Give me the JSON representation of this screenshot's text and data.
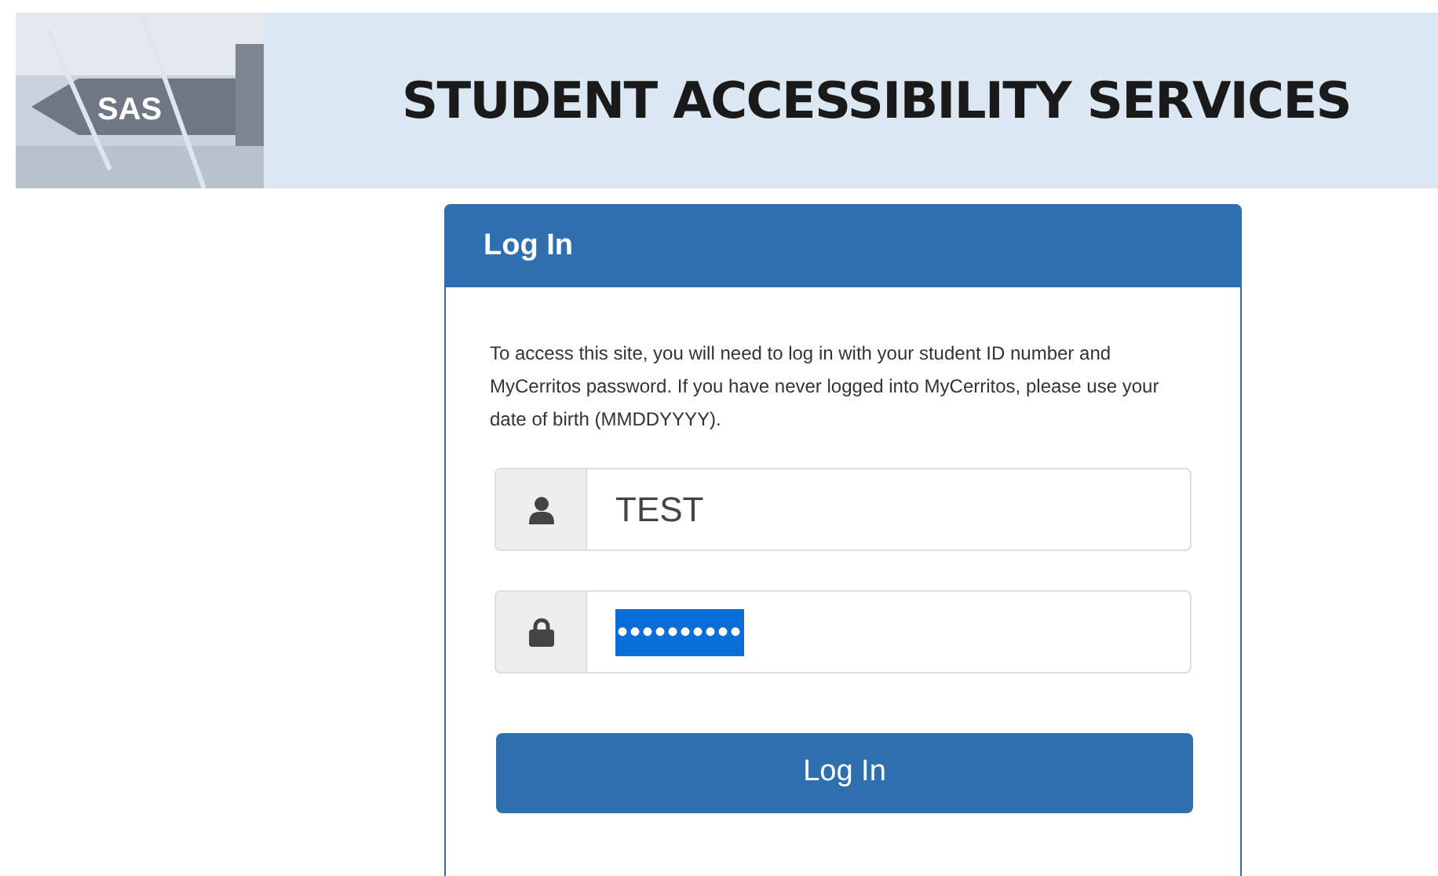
{
  "banner": {
    "logo_text": "SAS",
    "title": "STUDENT ACCESSIBILITY SERVICES"
  },
  "login": {
    "heading": "Log In",
    "instructions": "To access this site, you will need to log in with your student ID number and MyCerritos password. If you have never logged into MyCerritos, please use your date of birth (MMDDYYYY).",
    "fields": [
      {
        "kind": "user",
        "value": "TEST",
        "selected": false
      },
      {
        "kind": "password",
        "value": "••••••••••",
        "selected": true
      }
    ],
    "button": "Log In"
  }
}
